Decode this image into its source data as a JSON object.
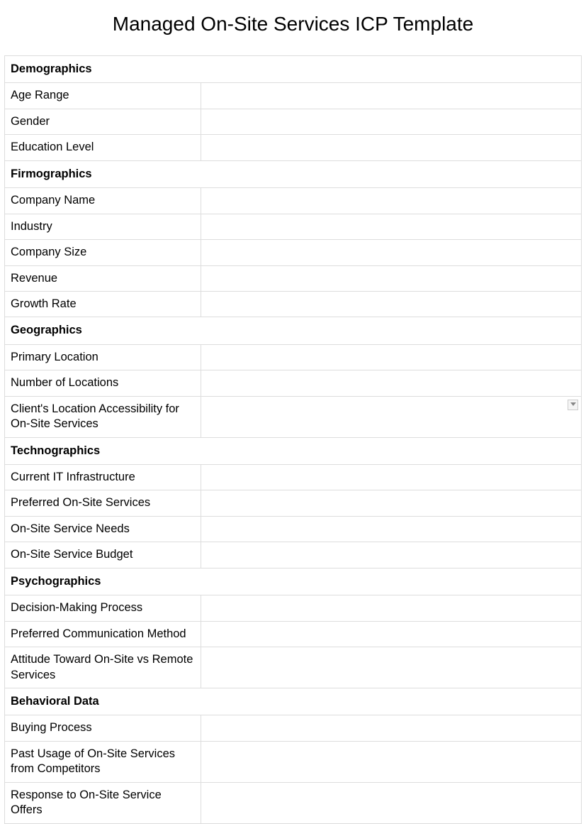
{
  "title": "Managed On-Site Services ICP Template",
  "sections": [
    {
      "name": "Demographics",
      "fields": [
        {
          "label": "Age Range",
          "value": "",
          "dropdown": false
        },
        {
          "label": "Gender",
          "value": "",
          "dropdown": false
        },
        {
          "label": "Education Level",
          "value": "",
          "dropdown": false
        }
      ]
    },
    {
      "name": "Firmographics",
      "fields": [
        {
          "label": "Company Name",
          "value": "",
          "dropdown": false
        },
        {
          "label": "Industry",
          "value": "",
          "dropdown": false
        },
        {
          "label": "Company Size",
          "value": "",
          "dropdown": false
        },
        {
          "label": "Revenue",
          "value": "",
          "dropdown": false
        },
        {
          "label": "Growth Rate",
          "value": "",
          "dropdown": false
        }
      ]
    },
    {
      "name": "Geographics",
      "fields": [
        {
          "label": "Primary Location",
          "value": "",
          "dropdown": false
        },
        {
          "label": "Number of Locations",
          "value": "",
          "dropdown": false
        },
        {
          "label": "Client's Location Accessibility for On-Site Services",
          "value": "",
          "dropdown": true
        }
      ]
    },
    {
      "name": "Technographics",
      "fields": [
        {
          "label": "Current IT Infrastructure",
          "value": "",
          "dropdown": false
        },
        {
          "label": "Preferred On-Site Services",
          "value": "",
          "dropdown": false
        },
        {
          "label": "On-Site Service Needs",
          "value": "",
          "dropdown": false
        },
        {
          "label": "On-Site Service Budget",
          "value": "",
          "dropdown": false
        }
      ]
    },
    {
      "name": "Psychographics",
      "fields": [
        {
          "label": "Decision-Making Process",
          "value": "",
          "dropdown": false
        },
        {
          "label": "Preferred Communication Method",
          "value": "",
          "dropdown": false
        },
        {
          "label": "Attitude Toward On-Site vs Remote Services",
          "value": "",
          "dropdown": false
        }
      ]
    },
    {
      "name": "Behavioral Data",
      "fields": [
        {
          "label": "Buying Process",
          "value": "",
          "dropdown": false
        },
        {
          "label": "Past Usage of On-Site Services from Competitors",
          "value": "",
          "dropdown": false
        },
        {
          "label": "Response to On-Site Service Offers",
          "value": "",
          "dropdown": false
        }
      ]
    }
  ]
}
